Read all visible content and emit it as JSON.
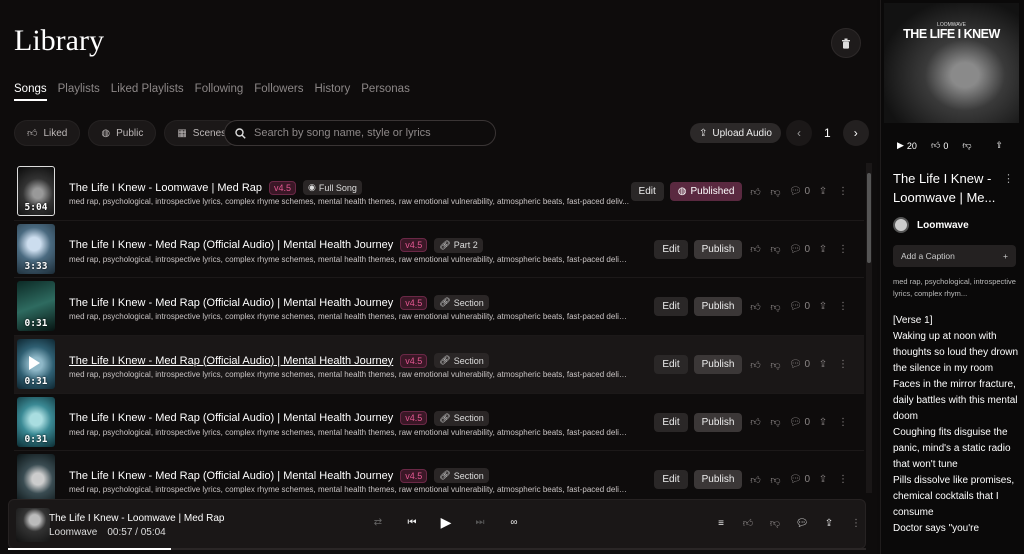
{
  "header": {
    "title": "Library"
  },
  "tabs": [
    "Songs",
    "Playlists",
    "Liked Playlists",
    "Following",
    "Followers",
    "History",
    "Personas"
  ],
  "filters": {
    "liked": "Liked",
    "public": "Public",
    "scenes": "Scenes"
  },
  "search": {
    "placeholder": "Search by song name, style or lyrics"
  },
  "upload_label": "Upload Audio",
  "page_number": "1",
  "songs": [
    {
      "title": "The Life I Knew - Loomwave | Med Rap",
      "version": "v4.5",
      "tag": "Full Song",
      "duration": "5:04",
      "desc": "med rap, psychological, introspective lyrics, complex rhyme schemes, mental health themes, raw emotional vulnerability, atmospheric beats, fast-paced deliv...",
      "edit": "Edit",
      "publish": "Published",
      "comments": "0"
    },
    {
      "title": "The Life I Knew - Med Rap (Official Audio) | Mental Health Journey",
      "version": "v4.5",
      "tag": "Part 2",
      "duration": "3:33",
      "desc": "med rap, psychological, introspective lyrics, complex rhyme schemes, mental health themes, raw emotional vulnerability, atmospheric beats, fast-paced delivery, str...",
      "edit": "Edit",
      "publish": "Publish",
      "comments": "0"
    },
    {
      "title": "The Life I Knew - Med Rap (Official Audio) | Mental Health Journey",
      "version": "v4.5",
      "tag": "Section",
      "duration": "0:31",
      "desc": "med rap, psychological, introspective lyrics, complex rhyme schemes, mental health themes, raw emotional vulnerability, atmospheric beats, fast-paced delivery, str...",
      "edit": "Edit",
      "publish": "Publish",
      "comments": "0"
    },
    {
      "title": "The Life I Knew - Med Rap (Official Audio) | Mental Health Journey",
      "version": "v4.5",
      "tag": "Section",
      "duration": "0:31",
      "desc": "med rap, psychological, introspective lyrics, complex rhyme schemes, mental health themes, raw emotional vulnerability, atmospheric beats, fast-paced delivery, str...",
      "edit": "Edit",
      "publish": "Publish",
      "comments": "0"
    },
    {
      "title": "The Life I Knew - Med Rap (Official Audio) | Mental Health Journey",
      "version": "v4.5",
      "tag": "Section",
      "duration": "0:31",
      "desc": "med rap, psychological, introspective lyrics, complex rhyme schemes, mental health themes, raw emotional vulnerability, atmospheric beats, fast-paced delivery, str...",
      "edit": "Edit",
      "publish": "Publish",
      "comments": "0"
    },
    {
      "title": "The Life I Knew - Med Rap (Official Audio) | Mental Health Journey",
      "version": "v4.5",
      "tag": "Section",
      "duration": "",
      "desc": "med rap, psychological, introspective lyrics, complex rhyme schemes, mental health themes, raw emotional vulnerability, atmospheric beats, fast-paced delivery, str...",
      "edit": "Edit",
      "publish": "Publish",
      "comments": "0"
    }
  ],
  "player": {
    "title": "The Life I Knew - Loomwave | Med Rap",
    "artist": "Loomwave",
    "time": "00:57 / 05:04",
    "progress": 0.19
  },
  "right_panel": {
    "cover_title": "THE LIFE I KNEW",
    "cover_sub": "LOOMWAVE",
    "plays": "20",
    "likes": "0",
    "title": "The Life I Knew - Loomwave | Me...",
    "artist": "Loomwave",
    "caption_label": "Add a Caption",
    "caption_add": "+",
    "tags": "med rap, psychological, introspective lyrics, complex rhym...",
    "lyrics": [
      "[Verse 1]",
      "Waking up at noon with thoughts so loud they drown the silence in my room",
      "Faces in the mirror fracture, daily battles with this mental doom",
      "Coughing fits disguise the panic, mind's a static radio that won't tune",
      "Pills dissolve like promises, chemical cocktails that I consume",
      "Doctor says \"you're"
    ]
  }
}
